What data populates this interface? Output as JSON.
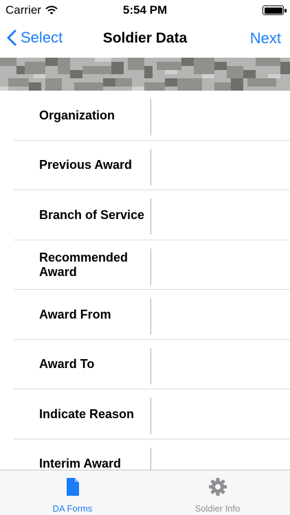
{
  "status_bar": {
    "carrier": "Carrier",
    "time": "5:54 PM",
    "icons": [
      "wifi-icon",
      "battery-icon"
    ]
  },
  "nav": {
    "back_label": "Select",
    "title": "Soldier Data",
    "next_label": "Next",
    "accent_color": "#1a7df7"
  },
  "form": {
    "rows": [
      {
        "label": "Organization",
        "value": ""
      },
      {
        "label": "Previous Award",
        "value": ""
      },
      {
        "label": "Branch of Service",
        "value": ""
      },
      {
        "label": "Recommended Award",
        "value": ""
      },
      {
        "label": "Award From",
        "value": ""
      },
      {
        "label": "Award To",
        "value": ""
      },
      {
        "label": "Indicate Reason",
        "value": ""
      },
      {
        "label": "Interim Award",
        "value": ""
      }
    ]
  },
  "tab_bar": {
    "tabs": [
      {
        "label": "DA Forms",
        "icon": "document-icon",
        "selected": true
      },
      {
        "label": "Soldier Info",
        "icon": "gear-icon",
        "selected": false
      }
    ]
  }
}
